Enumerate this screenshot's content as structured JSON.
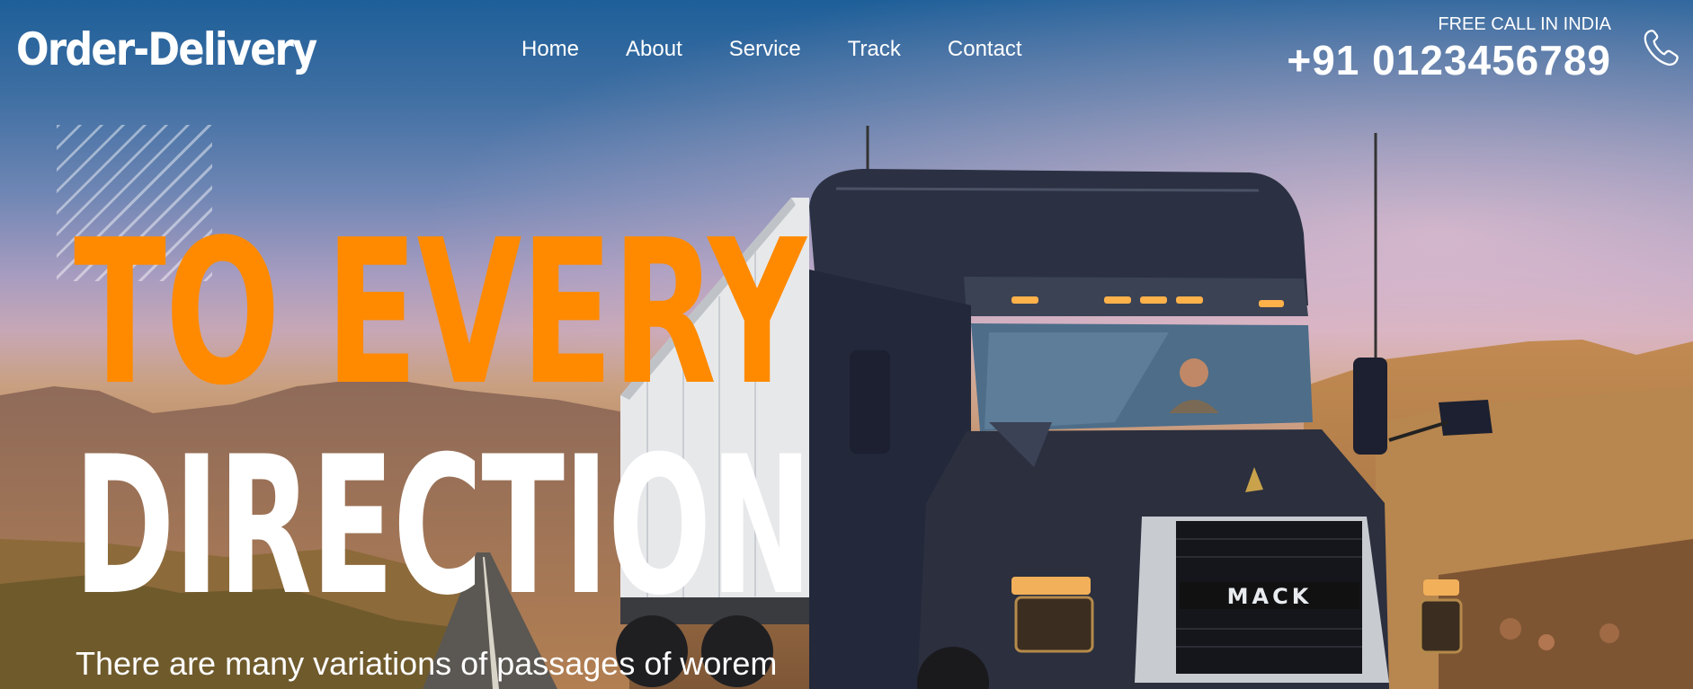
{
  "header": {
    "logo": "Order-Delivery",
    "nav": [
      {
        "label": "Home"
      },
      {
        "label": "About"
      },
      {
        "label": "Service"
      },
      {
        "label": "Track"
      },
      {
        "label": "Contact"
      }
    ],
    "call_label": "FREE CALL IN INDIA",
    "phone": "+91 0123456789",
    "phone_icon": "phone-icon"
  },
  "hero": {
    "headline_line1": "TO EVERY",
    "headline_line2": "DIRECTION",
    "subtext": "There are many variations of passages of worem",
    "truck_brand": "MACK"
  },
  "colors": {
    "accent": "#ff8a00",
    "text": "#ffffff",
    "sky_top": "#1e5f99"
  }
}
